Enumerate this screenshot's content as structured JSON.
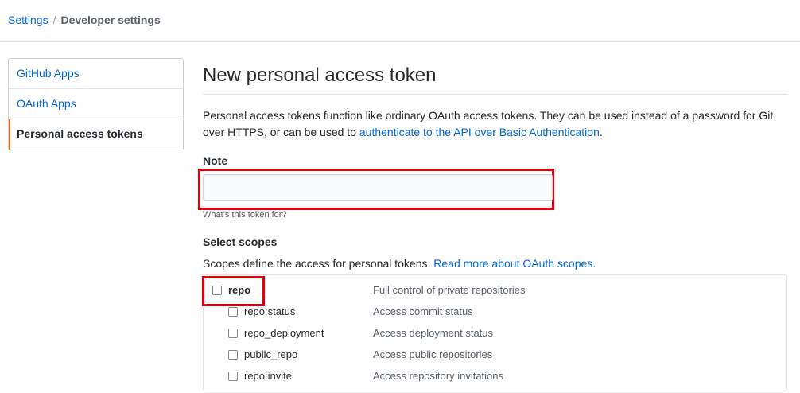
{
  "breadcrumb": {
    "root": "Settings",
    "separator": "/",
    "current": "Developer settings"
  },
  "sidebar": {
    "items": [
      {
        "label": "GitHub Apps"
      },
      {
        "label": "OAuth Apps"
      },
      {
        "label": "Personal access tokens"
      }
    ]
  },
  "main": {
    "title": "New personal access token",
    "description": "Personal access tokens function like ordinary OAuth access tokens. They can be used instead of a password for Git over HTTPS, or can be used to ",
    "description_link": "authenticate to the API over Basic Authentication",
    "description_end": ".",
    "note_label": "Note",
    "note_value": "",
    "note_hint": "What’s this token for?",
    "scopes_label": "Select scopes",
    "scopes_desc": "Scopes define the access for personal tokens. ",
    "scopes_link": "Read more about OAuth scopes.",
    "scopes": [
      {
        "name": "repo",
        "desc": "Full control of private repositories"
      },
      {
        "name": "repo:status",
        "desc": "Access commit status"
      },
      {
        "name": "repo_deployment",
        "desc": "Access deployment status"
      },
      {
        "name": "public_repo",
        "desc": "Access public repositories"
      },
      {
        "name": "repo:invite",
        "desc": "Access repository invitations"
      }
    ]
  },
  "colors": {
    "link": "#0366d6",
    "highlight": "#e0000f",
    "selected_accent": "#e36209"
  }
}
